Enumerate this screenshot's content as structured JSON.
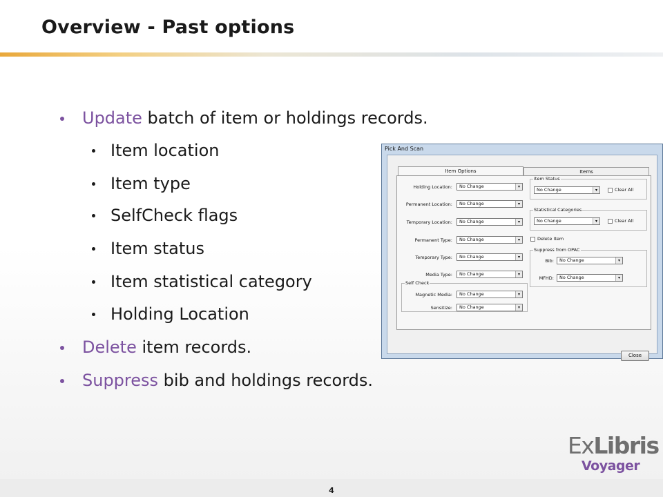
{
  "slide": {
    "title": "Overview - Past options",
    "bullets": [
      {
        "keyword": "Update",
        "rest": " batch of item or holdings records."
      },
      {
        "text": "Item location"
      },
      {
        "text": "Item type"
      },
      {
        "text": "SelfCheck flags"
      },
      {
        "text": "Item status"
      },
      {
        "text": "Item statistical category"
      },
      {
        "text": "Holding Location"
      },
      {
        "keyword": "Delete",
        "rest": " item records."
      },
      {
        "keyword": "Suppress",
        "rest": " bib and holdings records."
      }
    ],
    "page_number": "4",
    "logo": {
      "ex": "Ex",
      "libris": "Libris",
      "product": "Voyager"
    },
    "colors": {
      "accent": "#7c52a0",
      "title_rule": "#e9a83b"
    }
  },
  "dialog": {
    "title": "Pick And Scan",
    "tabs": [
      "Item Options",
      "Items"
    ],
    "fields": {
      "holding_location": {
        "label": "Holding Location:",
        "value": "No Change"
      },
      "permanent_location": {
        "label": "Permanent Location:",
        "value": "No Change"
      },
      "temporary_location": {
        "label": "Temporary Location:",
        "value": "No Change"
      },
      "permanent_type": {
        "label": "Permanent Type:",
        "value": "No Change"
      },
      "temporary_type": {
        "label": "Temporary Type:",
        "value": "No Change"
      },
      "media_type": {
        "label": "Media Type:",
        "value": "No Change"
      }
    },
    "self_check": {
      "group_label": "Self Check",
      "magnetic_media": {
        "label": "Magnetic Media:",
        "value": "No Change"
      },
      "sensitize": {
        "label": "Sensitize:",
        "value": "No Change"
      }
    },
    "item_status": {
      "group_label": "Item Status",
      "value": "No Change",
      "clear_all": "Clear All"
    },
    "statistical_categories": {
      "group_label": "Statistical Categories",
      "value": "No Change",
      "clear_all": "Clear All"
    },
    "delete_item": "Delete Item",
    "suppress": {
      "group_label": "Suppress from OPAC",
      "bib": {
        "label": "Bib:",
        "value": "No Change"
      },
      "mfhd": {
        "label": "MFHD:",
        "value": "No Change"
      }
    },
    "close_label": "Close"
  }
}
